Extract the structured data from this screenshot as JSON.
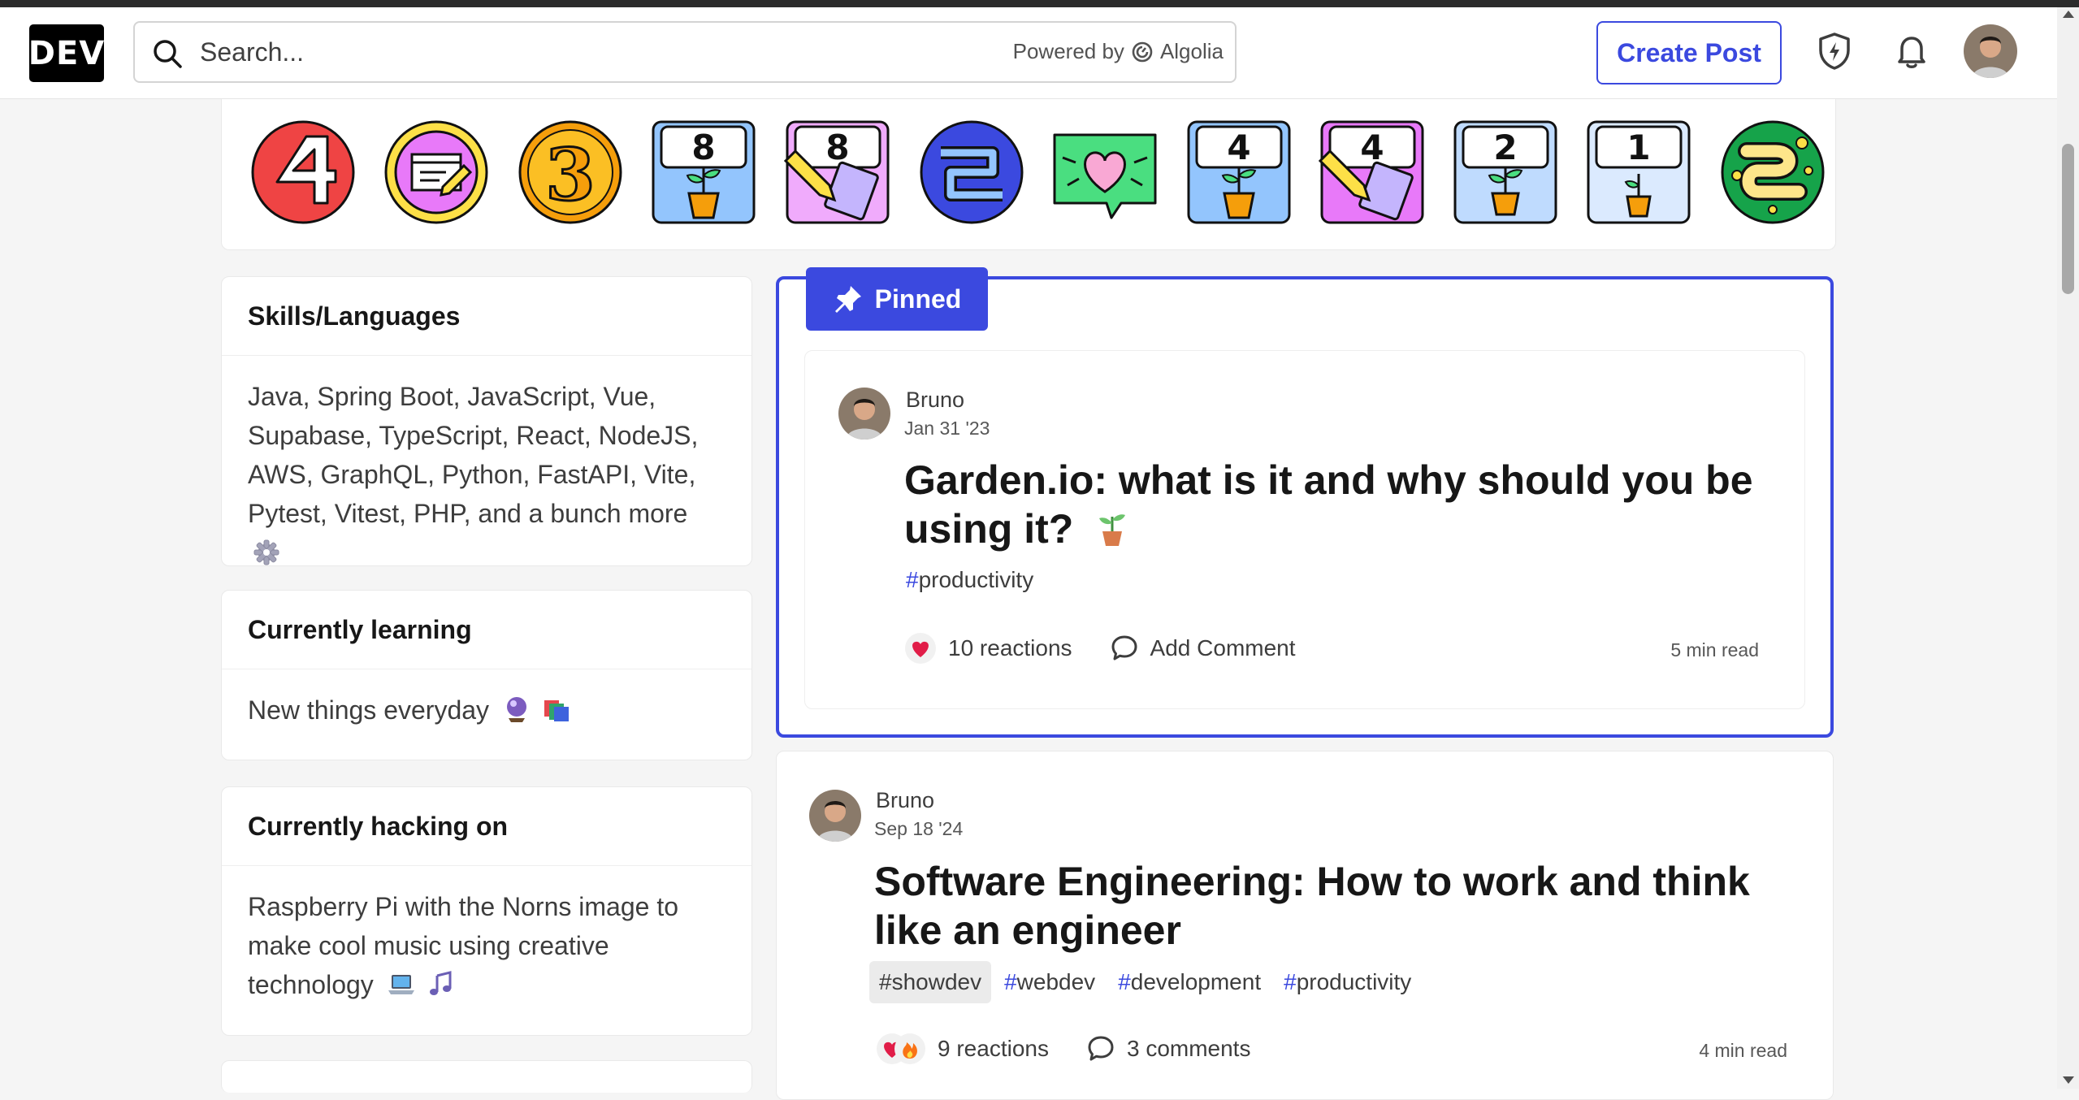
{
  "header": {
    "logo": "DEV",
    "search_placeholder": "Search...",
    "powered_by": "Powered by",
    "algolia": "Algolia",
    "create_post": "Create Post"
  },
  "colors": {
    "accent": "#3b49df",
    "pinned_bg": "#3b49df"
  },
  "badges": [
    "4-week-streak-badge",
    "writing-debut-badge",
    "3-year-club-badge",
    "8-week-community-wellness-badge",
    "8-week-writing-streak-badge",
    "2-week-streak-badge",
    "first-comment-badge",
    "4-week-community-wellness-badge",
    "4-week-writing-streak-badge",
    "2-week-community-wellness-badge",
    "1-week-community-wellness-badge",
    "2-year-club-badge"
  ],
  "sidebar": {
    "skills": {
      "title": "Skills/Languages",
      "body": "Java, Spring Boot, JavaScript, Vue, Supabase, TypeScript, React, NodeJS, AWS, GraphQL, Python, FastAPI, Vite, Pytest, Vitest, PHP, and a bunch more"
    },
    "learning": {
      "title": "Currently learning",
      "body": "New things everyday"
    },
    "hacking": {
      "title": "Currently hacking on",
      "body": "Raspberry Pi with the Norns image to make cool music using creative technology"
    }
  },
  "pinned_label": "Pinned",
  "posts": [
    {
      "author": "Bruno",
      "date": "Jan 31 '23",
      "title": "Garden.io: what is it and why should you be using it?",
      "tags": [
        "productivity"
      ],
      "reactions": "10 reactions",
      "comments": "Add Comment",
      "read_time": "5 min read"
    },
    {
      "author": "Bruno",
      "date": "Sep 18 '24",
      "title": "Software Engineering: How to work and think like an engineer",
      "tags": [
        "showdev",
        "webdev",
        "development",
        "productivity"
      ],
      "reactions": "9 reactions",
      "comments": "3 comments",
      "read_time": "4 min read"
    }
  ]
}
